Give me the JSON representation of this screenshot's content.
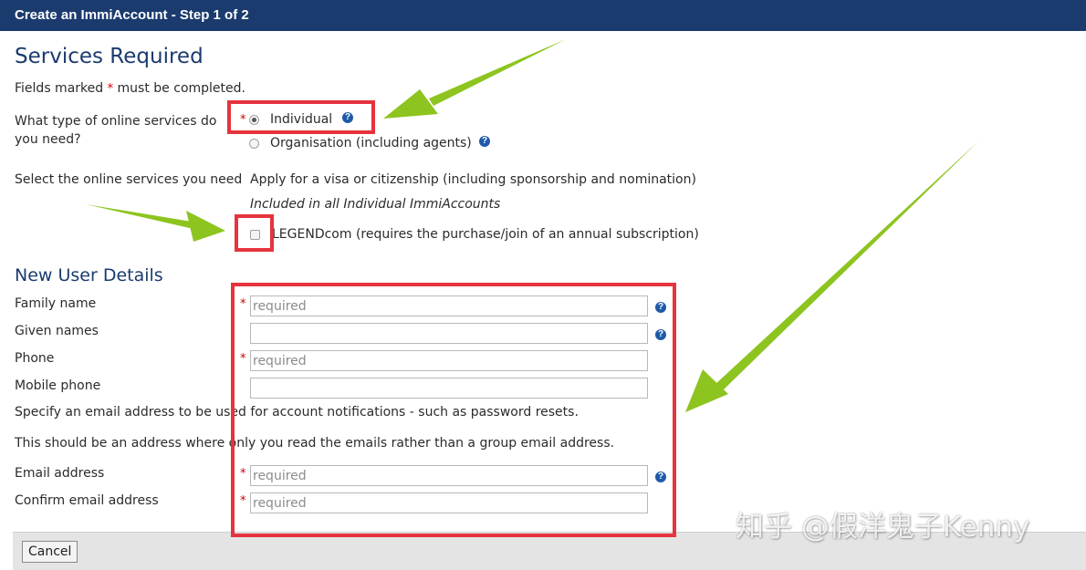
{
  "window": {
    "title": "Create an ImmiAccount - Step 1 of 2"
  },
  "services": {
    "heading": "Services Required",
    "fields_note_pre": "Fields marked",
    "required_mark": "*",
    "fields_note_post": "must be completed.",
    "type_question": "What type of online services do you need?",
    "options": [
      {
        "label": "Individual",
        "selected": true
      },
      {
        "label": "Organisation (including agents)",
        "selected": false
      }
    ],
    "select_label": "Select the online services you need",
    "service_apply": "Apply for a visa or citizenship (including sponsorship and nomination)",
    "service_included": "Included in all Individual ImmiAccounts",
    "legendcom_label": "LEGENDcom (requires the purchase/join of an annual subscription)",
    "legendcom_checked": false
  },
  "user": {
    "heading": "New User Details",
    "family_name_label": "Family name",
    "given_names_label": "Given names",
    "phone_label": "Phone",
    "mobile_label": "Mobile phone",
    "email_note_1": "Specify an email address to be used for account notifications - such as password resets.",
    "email_note_2": "This should be an address where only you read the emails rather than a group email address.",
    "email_label": "Email address",
    "confirm_email_label": "Confirm email address",
    "placeholder_required": "required"
  },
  "footer": {
    "cancel_label": "Cancel"
  },
  "watermark": {
    "text": "知乎 @假洋鬼子Kenny"
  },
  "colors": {
    "header_bg": "#1b3b6f",
    "heading": "#1b3b6f",
    "highlight": "#e5343d",
    "arrow": "#8dc41f",
    "help_icon": "#1f5aa8",
    "required": "#cc0000"
  }
}
